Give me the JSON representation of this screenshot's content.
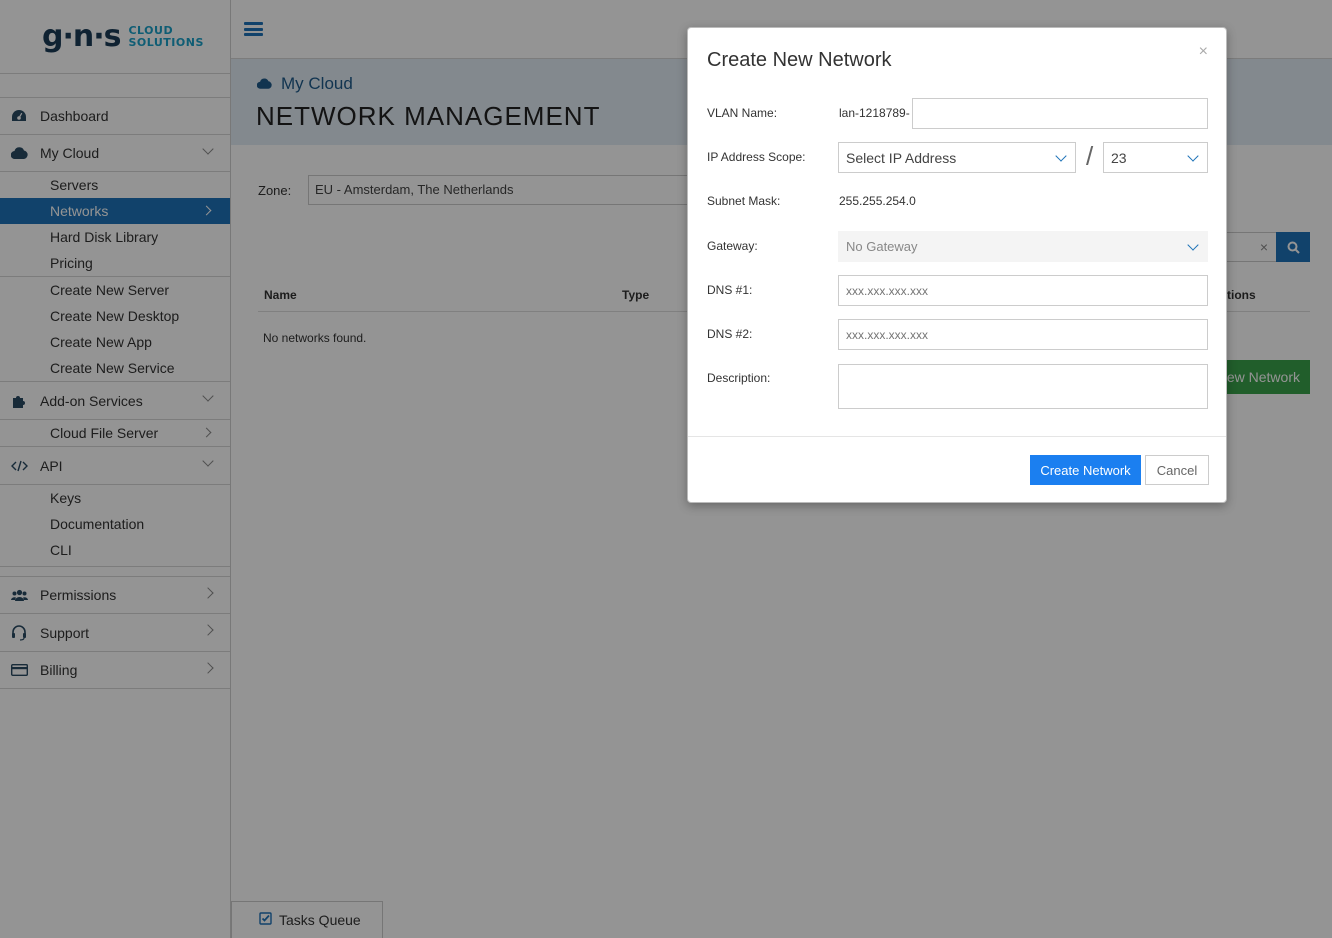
{
  "logo": {
    "mark": "g·n·s",
    "line1": "CLOUD",
    "line2": "SOLUTIONS"
  },
  "sidebar": {
    "items": [
      {
        "label": "Dashboard"
      },
      {
        "label": "My Cloud"
      },
      {
        "label": "Add-on Services"
      },
      {
        "label": "API"
      },
      {
        "label": "Permissions"
      },
      {
        "label": "Support"
      },
      {
        "label": "Billing"
      }
    ],
    "mycloud_sub": [
      "Servers",
      "Networks",
      "Hard Disk Library",
      "Pricing"
    ],
    "mycloud_create": [
      "Create New Server",
      "Create New Desktop",
      "Create New App",
      "Create New Service"
    ],
    "addon_sub": [
      "Cloud File Server"
    ],
    "api_sub": [
      "Keys",
      "Documentation",
      "CLI"
    ]
  },
  "header": {
    "crumb": "My Cloud",
    "title": "NETWORK MANAGEMENT"
  },
  "main": {
    "zone_label": "Zone:",
    "zone_value": "EU - Amsterdam, The Netherlands",
    "search_clear": "×",
    "columns": [
      "Name",
      "Type",
      "tions"
    ],
    "empty": "No networks found.",
    "new_network": "lew Network"
  },
  "tasks_queue": "Tasks Queue",
  "modal": {
    "title": "Create New Network",
    "close": "×",
    "vlan_label": "VLAN Name:",
    "vlan_prefix": "lan-1218789-",
    "vlan_value": "",
    "scope_label": "IP Address Scope:",
    "scope_value": "Select IP Address",
    "slash": "/",
    "prefix_value": "23",
    "mask_label": "Subnet Mask:",
    "mask_value": "255.255.254.0",
    "gateway_label": "Gateway:",
    "gateway_value": "No Gateway",
    "dns1_label": "DNS #1:",
    "dns1_placeholder": "xxx.xxx.xxx.xxx",
    "dns2_label": "DNS #2:",
    "dns2_placeholder": "xxx.xxx.xxx.xxx",
    "desc_label": "Description:",
    "create_btn": "Create Network",
    "cancel_btn": "Cancel"
  },
  "colors": {
    "primary": "#1e73b8",
    "button_blue": "#1b7ff0",
    "success": "#3aa24a"
  }
}
